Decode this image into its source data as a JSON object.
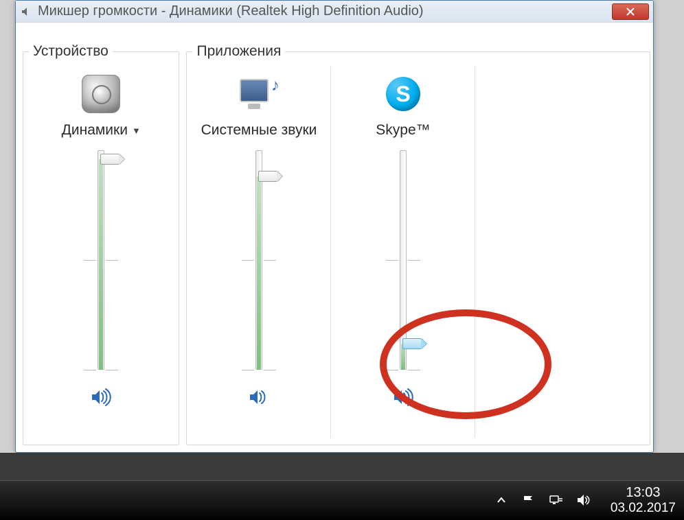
{
  "window": {
    "title": "Микшер громкости - Динамики (Realtek High Definition Audio)"
  },
  "groups": {
    "device": "Устройство",
    "applications": "Приложения"
  },
  "device": {
    "label": "Динамики",
    "volume_percent": 96
  },
  "apps": [
    {
      "label": "Системные звуки",
      "volume_percent": 88,
      "thumb_style": "normal"
    },
    {
      "label": "Skype™",
      "volume_percent": 12,
      "thumb_style": "blue"
    }
  ],
  "taskbar": {
    "time": "13:03",
    "date": "03.02.2017"
  }
}
